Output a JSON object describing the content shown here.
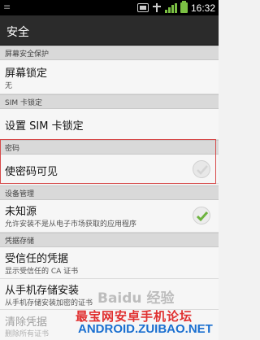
{
  "statusbar": {
    "left_text": "≡",
    "time": "16:32"
  },
  "title": "安全",
  "sections": {
    "screen_lock_header": "屏幕安全保护",
    "sim_header": "SIM 卡锁定",
    "password_header": "密码",
    "device_admin_header": "设备管理",
    "credential_header": "凭据存储"
  },
  "items": {
    "screen_lock": {
      "title": "屏幕锁定",
      "subtitle": "无"
    },
    "sim_lock": {
      "title": "设置 SIM 卡锁定"
    },
    "show_password": {
      "title": "使密码可见",
      "checked": false
    },
    "unknown_sources": {
      "title": "未知源",
      "subtitle": "允许安装不是从电子市场获取的应用程序",
      "checked": true
    },
    "trusted_credentials": {
      "title": "受信任的凭据",
      "subtitle": "显示受信任的 CA 证书"
    },
    "install_from_storage": {
      "title": "从手机存储安装",
      "subtitle": "从手机存储安装加密的证书"
    },
    "clear_credentials": {
      "title": "清除凭据",
      "subtitle": "删除所有证书"
    }
  },
  "watermark": {
    "baidu": "Baidu 经验",
    "line1": "最宝网安卓手机论坛",
    "line2": "ANDROID.ZUIBAO.NET"
  },
  "colors": {
    "check_green": "#6db33f",
    "highlight_frame": "#d64a4a"
  },
  "icons": [
    "status-box-icon",
    "usb-icon",
    "signal-icon",
    "battery-icon",
    "checkmark-icon"
  ]
}
